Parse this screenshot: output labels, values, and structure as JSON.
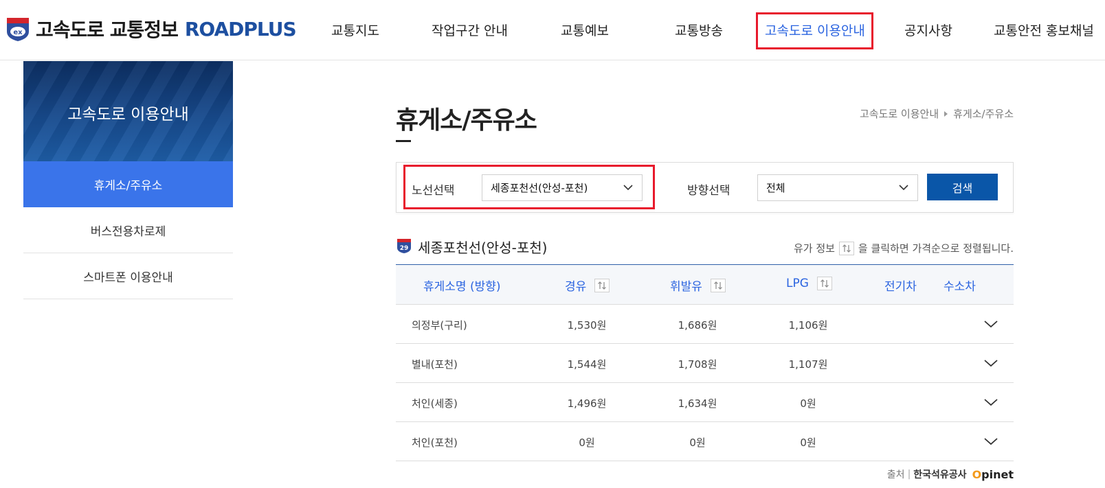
{
  "header": {
    "logo_title": "고속도로 교통정보",
    "logo_brand": "ROADPLUS",
    "logo_mark": "ex",
    "nav": [
      {
        "label": "교통지도",
        "active": false
      },
      {
        "label": "작업구간 안내",
        "active": false
      },
      {
        "label": "교통예보",
        "active": false
      },
      {
        "label": "교통방송",
        "active": false
      },
      {
        "label": "고속도로 이용안내",
        "active": true
      },
      {
        "label": "공지사항",
        "active": false
      },
      {
        "label": "교통안전 홍보채널",
        "active": false
      }
    ]
  },
  "sidebar": {
    "banner_title": "고속도로 이용안내",
    "items": [
      {
        "label": "휴게소/주유소",
        "active": true
      },
      {
        "label": "버스전용차로제",
        "active": false
      },
      {
        "label": "스마트폰 이용안내",
        "active": false
      }
    ]
  },
  "main": {
    "title": "휴게소/주유소",
    "breadcrumb": [
      "고속도로 이용안내",
      "휴게소/주유소"
    ],
    "filter": {
      "route_label": "노선선택",
      "route_value": "세종포천선(안성-포천)",
      "direction_label": "방향선택",
      "direction_value": "전체",
      "search_label": "검색"
    },
    "route_heading": {
      "route_number": "29",
      "name": "세종포천선(안성-포천)"
    },
    "sort_hint_before": "유가 정보",
    "sort_hint_after": "을 클릭하면 가격순으로 정렬됩니다.",
    "table": {
      "headers": [
        "휴게소명 (방향)",
        "경유",
        "휘발유",
        "LPG",
        "전기차",
        "수소차"
      ],
      "rows": [
        {
          "name": "의정부(구리)",
          "diesel": "1,530원",
          "gasoline": "1,686원",
          "lpg": "1,106원"
        },
        {
          "name": "별내(포천)",
          "diesel": "1,544원",
          "gasoline": "1,708원",
          "lpg": "1,107원"
        },
        {
          "name": "처인(세종)",
          "diesel": "1,496원",
          "gasoline": "1,634원",
          "lpg": "0원"
        },
        {
          "name": "처인(포천)",
          "diesel": "0원",
          "gasoline": "0원",
          "lpg": "0원"
        }
      ]
    },
    "source": {
      "label": "출처",
      "org": "한국석유공사",
      "brand_o": "O",
      "brand_rest": "pinet"
    }
  },
  "colors": {
    "accent": "#2b64e0",
    "sidebar_active": "#3a74ea",
    "search_button": "#0a56a8",
    "highlight_box": "#e8192c"
  }
}
